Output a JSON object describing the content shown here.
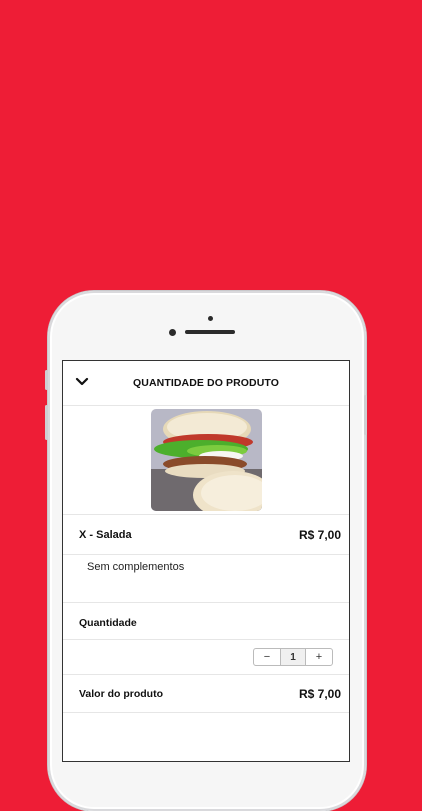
{
  "header": {
    "title": "QUANTIDADE DO PRODUTO",
    "back_icon": "chevron-down-icon"
  },
  "product": {
    "image_icon": "burger-photo",
    "name": "X - Salada",
    "price": "R$ 7,00",
    "complements": "Sem complementos"
  },
  "quantity": {
    "label": "Quantidade",
    "minus": "−",
    "value": "1",
    "plus": "+"
  },
  "total": {
    "label": "Valor do produto",
    "value": "R$ 7,00"
  },
  "colors": {
    "background": "#ee1d36",
    "phone": "#f6f6f6",
    "screen": "#ffffff"
  }
}
